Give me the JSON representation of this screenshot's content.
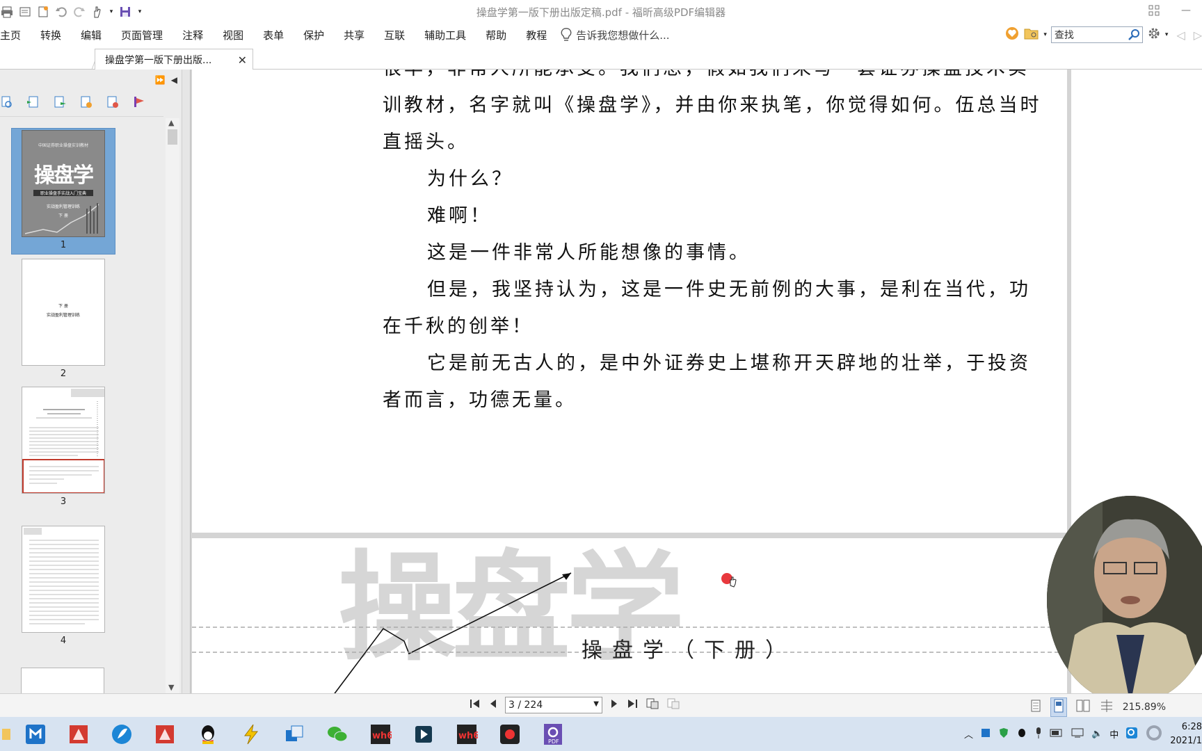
{
  "window": {
    "title": "操盘学第一版下册出版定稿.pdf - 福昕高级PDF编辑器"
  },
  "menu": {
    "items": [
      "主页",
      "转换",
      "编辑",
      "页面管理",
      "注释",
      "视图",
      "表单",
      "保护",
      "共享",
      "互联",
      "辅助工具",
      "帮助",
      "教程"
    ],
    "tell_me": "告诉我您想做什么..."
  },
  "search": {
    "placeholder": "查找"
  },
  "tab": {
    "label": "操盘学第一版下册出版..."
  },
  "thumbnails": {
    "pages": [
      "1",
      "2",
      "3",
      "4"
    ],
    "page1_caption_top": "中国证券职业操盘实训教材",
    "page1_title": "操盘学",
    "page1_sub": "职业操盘手实战入门宝典",
    "page1_part": "实战盈利管理训练",
    "page1_vol": "下 册",
    "page2_line1": "下 册",
    "page2_line2": "实战盈利管理训练"
  },
  "document": {
    "paragraphs": [
      {
        "text": "很早，非常人所能承受。我们想，假如我们来写一套证券操盘技术实",
        "indent": false,
        "cut": true
      },
      {
        "text": "训教材，名字就叫《操盘学》，并由你来执笔，你觉得如何。伍总当时",
        "indent": false
      },
      {
        "text": "直摇头。",
        "indent": false
      },
      {
        "text": "为什么？",
        "indent": true
      },
      {
        "text": "难啊！",
        "indent": true
      },
      {
        "text": "这是一件非常人所能想像的事情。",
        "indent": true
      },
      {
        "text": "但是，我坚持认为，这是一件史无前例的大事，是利在当代，功",
        "indent": true
      },
      {
        "text": "在千秋的创举！",
        "indent": false
      },
      {
        "text": "它是前无古人的，是中外证券史上堪称开天辟地的壮举，于投资",
        "indent": true
      },
      {
        "text": "者而言，功德无量。",
        "indent": false
      }
    ],
    "cover_big": "操盘学",
    "cover_subtitle": "操盘学（下册）"
  },
  "navigation": {
    "page_indicator": "3 / 224",
    "zoom": "215.89%"
  },
  "taskbar": {
    "time": "6:28",
    "date": "2021/1"
  },
  "colors": {
    "selected_thumb": "#74a6d6",
    "taskbar": "#d7e3f1",
    "accent_red": "#e8383d"
  }
}
